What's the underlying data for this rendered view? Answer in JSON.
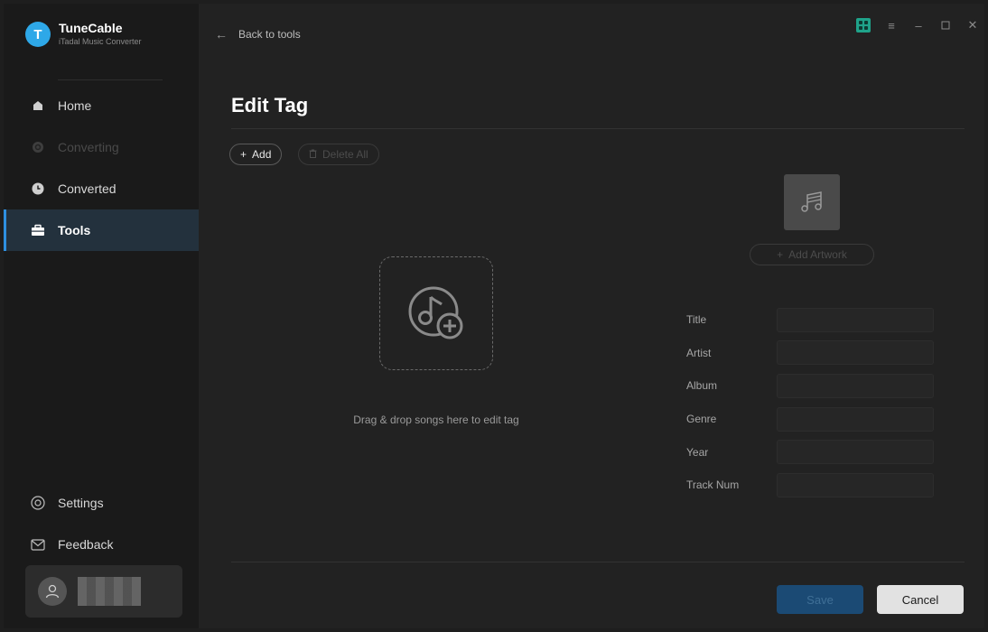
{
  "brand": {
    "name": "TuneCable",
    "subtitle": "iTadal Music Converter",
    "logo_letter": "T",
    "accent": "#2ea8e8"
  },
  "sidebar": {
    "items": [
      {
        "label": "Home",
        "icon": "home-icon",
        "state": "normal"
      },
      {
        "label": "Converting",
        "icon": "converting-icon",
        "state": "disabled"
      },
      {
        "label": "Converted",
        "icon": "clock-icon",
        "state": "normal"
      },
      {
        "label": "Tools",
        "icon": "toolbox-icon",
        "state": "active"
      }
    ],
    "bottom_items": [
      {
        "label": "Settings",
        "icon": "settings-icon"
      },
      {
        "label": "Feedback",
        "icon": "mail-icon"
      }
    ]
  },
  "topbar": {
    "back_label": "Back to tools"
  },
  "page": {
    "title": "Edit Tag"
  },
  "toolbar": {
    "add_label": "Add",
    "delete_all_label": "Delete All"
  },
  "drop": {
    "text": "Drag & drop songs here to edit tag"
  },
  "artwork": {
    "add_label": "Add Artwork"
  },
  "fields": [
    {
      "label": "Title",
      "value": ""
    },
    {
      "label": "Artist",
      "value": ""
    },
    {
      "label": "Album",
      "value": ""
    },
    {
      "label": "Genre",
      "value": ""
    },
    {
      "label": "Year",
      "value": ""
    },
    {
      "label": "Track Num",
      "value": ""
    }
  ],
  "actions": {
    "save_label": "Save",
    "cancel_label": "Cancel"
  },
  "colors": {
    "active_nav": "#2e8fe0",
    "save_button": "#1b4a74",
    "grid_icon": "#1fa38a"
  }
}
